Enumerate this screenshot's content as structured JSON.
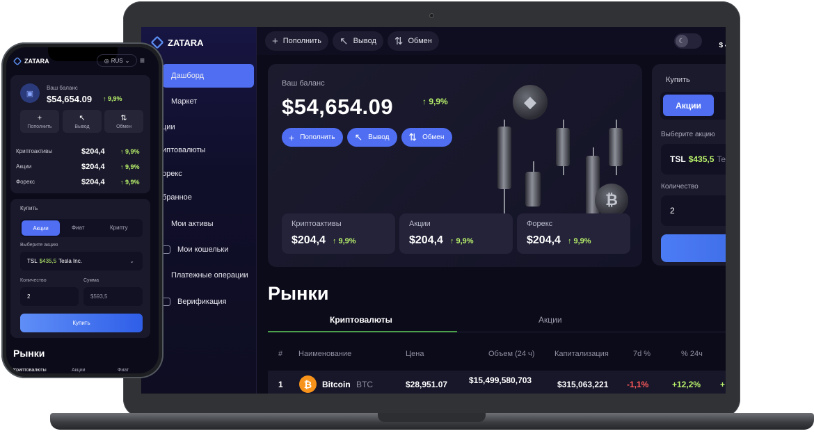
{
  "brand": {
    "name": "ZATARA"
  },
  "sidebar": {
    "items": [
      {
        "label": "Дашборд"
      },
      {
        "label": "Маркет"
      },
      {
        "label": "ции"
      },
      {
        "label": "иптовалюты"
      },
      {
        "label": "орекс"
      },
      {
        "label": "бранное"
      },
      {
        "label": "Мои активы"
      },
      {
        "label": "Мои кошельки"
      },
      {
        "label": "Платежные операции"
      },
      {
        "label": "Верификация"
      }
    ]
  },
  "topbar": {
    "buttons": [
      {
        "label": "Пополнить",
        "icon": "plus-icon"
      },
      {
        "label": "Вывод",
        "icon": "arrow-up-left-icon"
      },
      {
        "label": "Обмен",
        "icon": "swap-icon"
      }
    ],
    "balance_partial": "$ 49"
  },
  "balance": {
    "label": "Ваш баланс",
    "value": "$54,654.09",
    "change": "9,9%",
    "actions": [
      {
        "label": "Пополнить"
      },
      {
        "label": "Вывод"
      },
      {
        "label": "Обмен"
      }
    ],
    "assets": [
      {
        "name": "Криптоактивы",
        "value": "$204,4",
        "change": "9,9%"
      },
      {
        "name": "Акции",
        "value": "$204,4",
        "change": "9,9%"
      },
      {
        "name": "Форекс",
        "value": "$204,4",
        "change": "9,9%"
      }
    ]
  },
  "buy": {
    "title": "Купить",
    "active_tab": "Акции",
    "select_label": "Выберите акцию",
    "ticker": "TSL",
    "price": "$435,5",
    "company_partial": "Te",
    "qty_label": "Количество",
    "qty_value": "2"
  },
  "markets": {
    "title": "Рынки",
    "tabs": [
      {
        "label": "Криптовалюты",
        "active": true
      },
      {
        "label": "Акции",
        "active": false
      }
    ],
    "headers": [
      "#",
      "Наименование",
      "Цена",
      "Объем (24 ч)",
      "Капитализация",
      "7d %",
      "% 24ч"
    ],
    "rows": [
      {
        "rank": "1",
        "name": "Bitcoin",
        "symbol": "BTC",
        "price": "$28,951.07",
        "volume": "$15,499,580,703",
        "cap": "$315,063,221",
        "d7": "-1,1%",
        "h24": "+12,2%",
        "extra": "+"
      }
    ]
  },
  "phone": {
    "lang": "RUS",
    "balance_label": "Ваш баланс",
    "balance_value": "$54,654.09",
    "balance_change": "9,9%",
    "actions": [
      {
        "label": "Пополнить"
      },
      {
        "label": "Вывод"
      },
      {
        "label": "Обмен"
      }
    ],
    "assets": [
      {
        "name": "Криптоактивы",
        "value": "$204,4",
        "change": "9,9%"
      },
      {
        "name": "Акции",
        "value": "$204,4",
        "change": "9,9%"
      },
      {
        "name": "Форекс",
        "value": "$204,4",
        "change": "9,9%"
      }
    ],
    "buy_title": "Купить",
    "buy_tabs": [
      {
        "label": "Акции"
      },
      {
        "label": "Фиат"
      },
      {
        "label": "Крипту"
      }
    ],
    "select_label": "Выберите акцию",
    "select_ticker": "TSL",
    "select_price": "$435,5",
    "select_company": "Tesla Inc.",
    "qty_label": "Количество",
    "sum_label": "Сумма",
    "qty_value": "2",
    "sum_value": "$593,5",
    "buy_button": "Купить",
    "markets_title": "Рынки",
    "market_tabs": [
      {
        "label": "Криптовалюты"
      },
      {
        "label": "Акции"
      },
      {
        "label": "Фиат"
      }
    ]
  },
  "colors": {
    "accent": "#4f6ef2",
    "positive": "#b9f26a",
    "negative": "#ff5a5a",
    "bitcoin": "#f7931a"
  }
}
